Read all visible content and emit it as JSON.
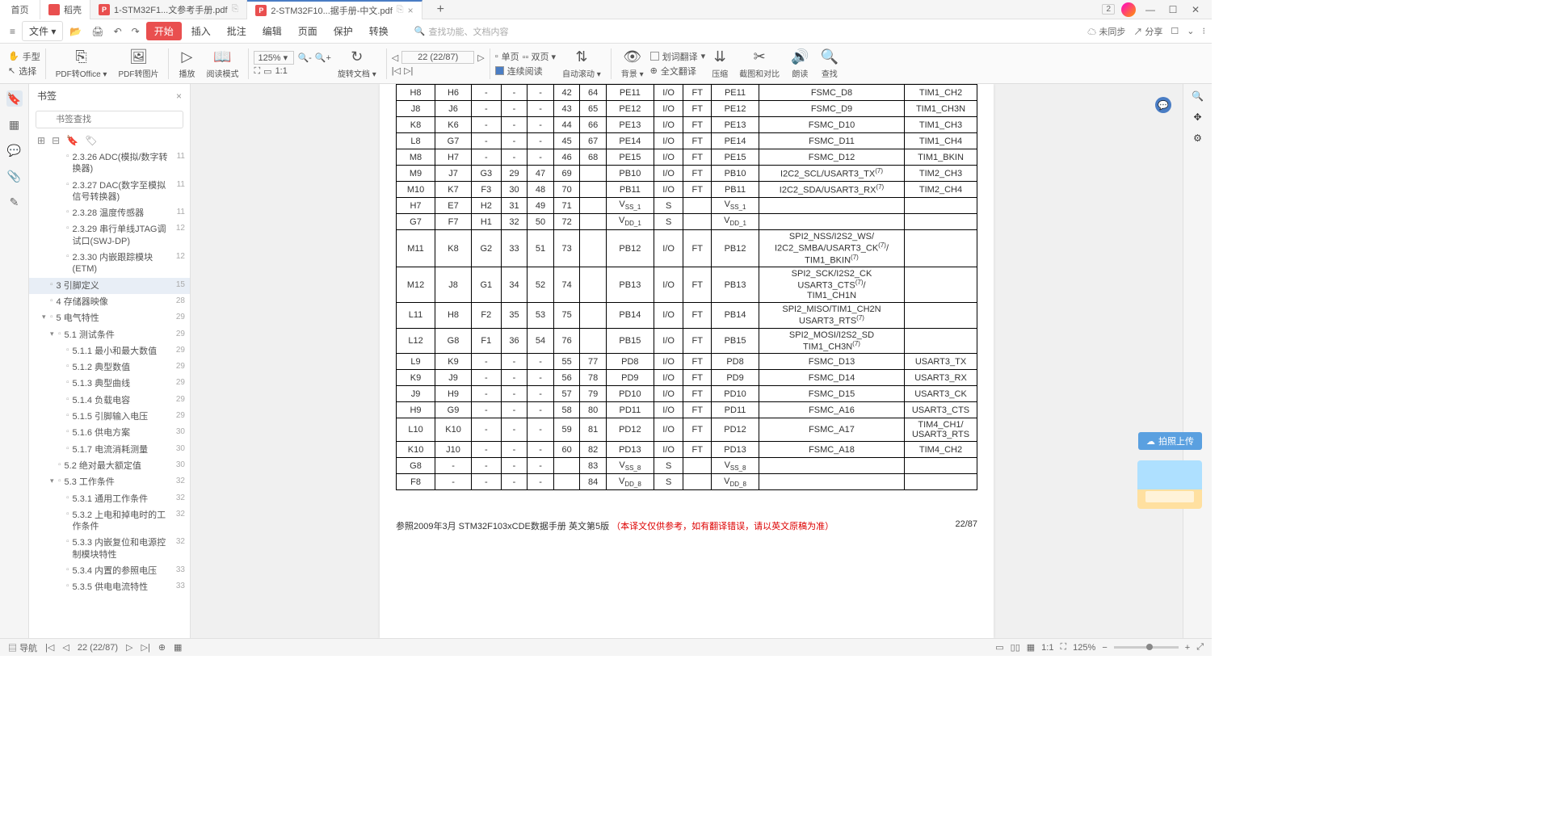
{
  "titlebar": {
    "home": "首页",
    "docke": "稻壳",
    "tab1": "1-STM32F1...文参考手册.pdf",
    "tab2": "2-STM32F10...据手册-中文.pdf",
    "badge": "2"
  },
  "menubar": {
    "file": "文件",
    "start": "开始",
    "items": [
      "插入",
      "批注",
      "编辑",
      "页面",
      "保护",
      "转换"
    ],
    "search_placeholder": "查找功能、文档内容",
    "unsync": "未同步",
    "share": "分享"
  },
  "toolbar": {
    "hand": "手型",
    "select": "选择",
    "pdf_office": "PDF转Office",
    "pdf_img": "PDF转图片",
    "play": "播放",
    "read_mode": "阅读模式",
    "zoom": "125%",
    "rotate": "旋转文档",
    "page_nav": "22 (22/87)",
    "single": "单页",
    "double": "双页",
    "cont_read": "连续阅读",
    "auto_scroll": "自动滚动",
    "bg": "背景",
    "word_trans": "划词翻译",
    "full_trans": "全文翻译",
    "compress": "压缩",
    "screenshot": "截图和对比",
    "read_aloud": "朗读",
    "find": "查找"
  },
  "sidebar": {
    "title": "书签",
    "search_placeholder": "书签查找",
    "items": [
      {
        "text": "2.3.26 ADC(模拟/数字转换器)",
        "pg": "11",
        "indent": 3
      },
      {
        "text": "2.3.27 DAC(数字至模拟信号转换器)",
        "pg": "11",
        "indent": 3
      },
      {
        "text": "2.3.28 温度传感器",
        "pg": "11",
        "indent": 3
      },
      {
        "text": "2.3.29 串行单线JTAG调试口(SWJ-DP)",
        "pg": "12",
        "indent": 3
      },
      {
        "text": "2.3.30 内嵌跟踪模块(ETM)",
        "pg": "12",
        "indent": 3
      },
      {
        "text": "3 引脚定义",
        "pg": "15",
        "indent": 1,
        "selected": true
      },
      {
        "text": "4 存储器映像",
        "pg": "28",
        "indent": 1
      },
      {
        "text": "5 电气特性",
        "pg": "29",
        "indent": 1,
        "arrow": "▾"
      },
      {
        "text": "5.1 测试条件",
        "pg": "29",
        "indent": 2,
        "arrow": "▾"
      },
      {
        "text": "5.1.1 最小和最大数值",
        "pg": "29",
        "indent": 3
      },
      {
        "text": "5.1.2 典型数值",
        "pg": "29",
        "indent": 3
      },
      {
        "text": "5.1.3 典型曲线",
        "pg": "29",
        "indent": 3
      },
      {
        "text": "5.1.4 负载电容",
        "pg": "29",
        "indent": 3
      },
      {
        "text": "5.1.5 引脚输入电压",
        "pg": "29",
        "indent": 3
      },
      {
        "text": "5.1.6 供电方案",
        "pg": "30",
        "indent": 3
      },
      {
        "text": "5.1.7 电流消耗测量",
        "pg": "30",
        "indent": 3
      },
      {
        "text": "5.2 绝对最大额定值",
        "pg": "30",
        "indent": 2
      },
      {
        "text": "5.3 工作条件",
        "pg": "32",
        "indent": 2,
        "arrow": "▾"
      },
      {
        "text": "5.3.1 通用工作条件",
        "pg": "32",
        "indent": 3
      },
      {
        "text": "5.3.2 上电和掉电时的工作条件",
        "pg": "32",
        "indent": 3
      },
      {
        "text": "5.3.3 内嵌复位和电源控制模块特性",
        "pg": "32",
        "indent": 3
      },
      {
        "text": "5.3.4 内置的参照电压",
        "pg": "33",
        "indent": 3
      },
      {
        "text": "5.3.5 供电电流特性",
        "pg": "33",
        "indent": 3
      }
    ]
  },
  "table_rows": [
    [
      "H8",
      "H6",
      "-",
      "-",
      "-",
      "42",
      "64",
      "PE11",
      "I/O",
      "FT",
      "PE11",
      "FSMC_D8",
      "TIM1_CH2"
    ],
    [
      "J8",
      "J6",
      "-",
      "-",
      "-",
      "43",
      "65",
      "PE12",
      "I/O",
      "FT",
      "PE12",
      "FSMC_D9",
      "TIM1_CH3N"
    ],
    [
      "K8",
      "K6",
      "-",
      "-",
      "-",
      "44",
      "66",
      "PE13",
      "I/O",
      "FT",
      "PE13",
      "FSMC_D10",
      "TIM1_CH3"
    ],
    [
      "L8",
      "G7",
      "-",
      "-",
      "-",
      "45",
      "67",
      "PE14",
      "I/O",
      "FT",
      "PE14",
      "FSMC_D11",
      "TIM1_CH4"
    ],
    [
      "M8",
      "H7",
      "-",
      "-",
      "-",
      "46",
      "68",
      "PE15",
      "I/O",
      "FT",
      "PE15",
      "FSMC_D12",
      "TIM1_BKIN"
    ],
    [
      "M9",
      "J7",
      "G3",
      "29",
      "47",
      "69",
      "",
      "PB10",
      "I/O",
      "FT",
      "PB10",
      "I2C2_SCL/USART3_TX(7)",
      "TIM2_CH3"
    ],
    [
      "M10",
      "K7",
      "F3",
      "30",
      "48",
      "70",
      "",
      "PB11",
      "I/O",
      "FT",
      "PB11",
      "I2C2_SDA/USART3_RX(7)",
      "TIM2_CH4"
    ],
    [
      "H7",
      "E7",
      "H2",
      "31",
      "49",
      "71",
      "",
      "VSS_1",
      "S",
      "",
      "VSS_1",
      "",
      ""
    ],
    [
      "G7",
      "F7",
      "H1",
      "32",
      "50",
      "72",
      "",
      "VDD_1",
      "S",
      "",
      "VDD_1",
      "",
      ""
    ],
    [
      "M11",
      "K8",
      "G2",
      "33",
      "51",
      "73",
      "",
      "PB12",
      "I/O",
      "FT",
      "PB12",
      "SPI2_NSS/I2S2_WS/\nI2C2_SMBA/USART3_CK(7)/\nTIM1_BKIN(7)",
      ""
    ],
    [
      "M12",
      "J8",
      "G1",
      "34",
      "52",
      "74",
      "",
      "PB13",
      "I/O",
      "FT",
      "PB13",
      "SPI2_SCK/I2S2_CK\nUSART3_CTS(7)/\nTIM1_CH1N",
      ""
    ],
    [
      "L11",
      "H8",
      "F2",
      "35",
      "53",
      "75",
      "",
      "PB14",
      "I/O",
      "FT",
      "PB14",
      "SPI2_MISO/TIM1_CH2N\nUSART3_RTS(7)",
      ""
    ],
    [
      "L12",
      "G8",
      "F1",
      "36",
      "54",
      "76",
      "",
      "PB15",
      "I/O",
      "FT",
      "PB15",
      "SPI2_MOSI/I2S2_SD\nTIM1_CH3N(7)",
      ""
    ],
    [
      "L9",
      "K9",
      "-",
      "-",
      "-",
      "55",
      "77",
      "PD8",
      "I/O",
      "FT",
      "PD8",
      "FSMC_D13",
      "USART3_TX"
    ],
    [
      "K9",
      "J9",
      "-",
      "-",
      "-",
      "56",
      "78",
      "PD9",
      "I/O",
      "FT",
      "PD9",
      "FSMC_D14",
      "USART3_RX"
    ],
    [
      "J9",
      "H9",
      "-",
      "-",
      "-",
      "57",
      "79",
      "PD10",
      "I/O",
      "FT",
      "PD10",
      "FSMC_D15",
      "USART3_CK"
    ],
    [
      "H9",
      "G9",
      "-",
      "-",
      "-",
      "58",
      "80",
      "PD11",
      "I/O",
      "FT",
      "PD11",
      "FSMC_A16",
      "USART3_CTS"
    ],
    [
      "L10",
      "K10",
      "-",
      "-",
      "-",
      "59",
      "81",
      "PD12",
      "I/O",
      "FT",
      "PD12",
      "FSMC_A17",
      "TIM4_CH1/\nUSART3_RTS"
    ],
    [
      "K10",
      "J10",
      "-",
      "-",
      "-",
      "60",
      "82",
      "PD13",
      "I/O",
      "FT",
      "PD13",
      "FSMC_A18",
      "TIM4_CH2"
    ],
    [
      "G8",
      "-",
      "-",
      "-",
      "-",
      "",
      "83",
      "VSS_8",
      "S",
      "",
      "VSS_8",
      "",
      ""
    ],
    [
      "F8",
      "-",
      "-",
      "-",
      "-",
      "",
      "84",
      "VDD_8",
      "S",
      "",
      "VDD_8",
      "",
      ""
    ]
  ],
  "footer": {
    "left": "参照2009年3月 STM32F103xCDE数据手册 英文第5版",
    "red": "（本译文仅供参考，如有翻译错误，请以英文原稿为准）",
    "right": "22/87"
  },
  "statusbar": {
    "nav": "导航",
    "page": "22 (22/87)",
    "zoom": "125%"
  },
  "float": {
    "upload": "拍照上传"
  }
}
